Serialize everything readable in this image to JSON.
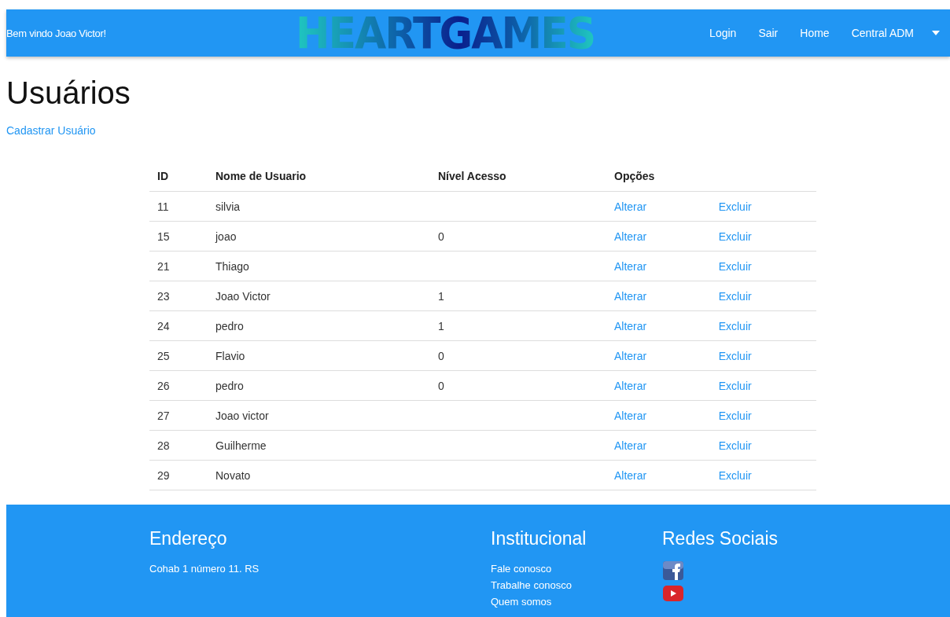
{
  "navbar": {
    "welcome": "Bem vindo Joao Victor!",
    "logo": "HEARTGAMES",
    "links": [
      "Login",
      "Sair",
      "Home",
      "Central ADM"
    ]
  },
  "page": {
    "title": "Usuários",
    "register_link": "Cadastrar Usuário"
  },
  "table": {
    "columns": [
      "ID",
      "Nome de Usuario",
      "Nível Acesso",
      "Opções"
    ],
    "rows": [
      {
        "id": "11",
        "name": "silvia",
        "level": "",
        "edit": "Alterar",
        "delete": "Excluir"
      },
      {
        "id": "15",
        "name": "joao",
        "level": "0",
        "edit": "Alterar",
        "delete": "Excluir"
      },
      {
        "id": "21",
        "name": "Thiago",
        "level": "",
        "edit": "Alterar",
        "delete": "Excluir"
      },
      {
        "id": "23",
        "name": "Joao Victor",
        "level": "1",
        "edit": "Alterar",
        "delete": "Excluir"
      },
      {
        "id": "24",
        "name": "pedro",
        "level": "1",
        "edit": "Alterar",
        "delete": "Excluir"
      },
      {
        "id": "25",
        "name": "Flavio",
        "level": "0",
        "edit": "Alterar",
        "delete": "Excluir"
      },
      {
        "id": "26",
        "name": "pedro",
        "level": "0",
        "edit": "Alterar",
        "delete": "Excluir"
      },
      {
        "id": "27",
        "name": "Joao victor",
        "level": "",
        "edit": "Alterar",
        "delete": "Excluir"
      },
      {
        "id": "28",
        "name": "Guilherme",
        "level": "",
        "edit": "Alterar",
        "delete": "Excluir"
      },
      {
        "id": "29",
        "name": "Novato",
        "level": "",
        "edit": "Alterar",
        "delete": "Excluir"
      }
    ]
  },
  "footer": {
    "address": {
      "title": "Endereço",
      "text": "Cohab 1 número 11. RS"
    },
    "institutional": {
      "title": "Institucional",
      "links": [
        "Fale conosco",
        "Trabalhe conosco",
        "Quem somos"
      ]
    },
    "social": {
      "title": "Redes Sociais",
      "items": [
        {
          "kind": "facebook"
        },
        {
          "kind": "youtube"
        }
      ]
    }
  }
}
